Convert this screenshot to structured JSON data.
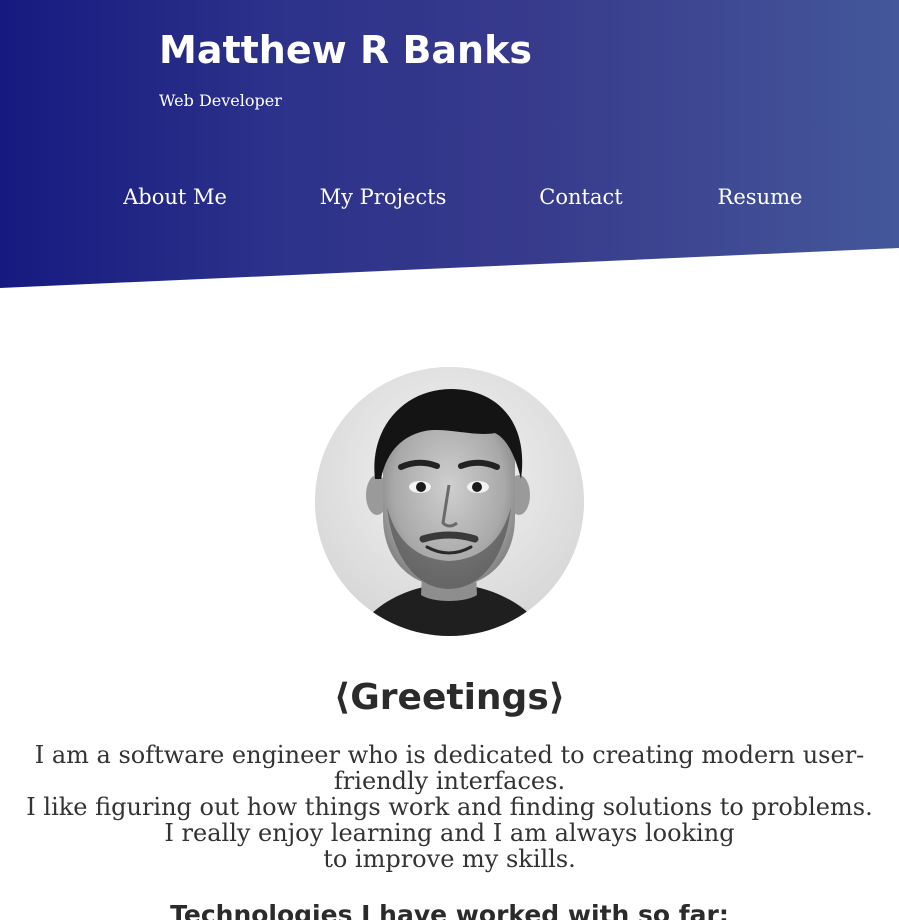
{
  "header": {
    "name": "Matthew R Banks",
    "subtitle": "Web Developer"
  },
  "nav": {
    "items": [
      {
        "label": "About Me"
      },
      {
        "label": "My Projects"
      },
      {
        "label": "Contact"
      },
      {
        "label": "Resume"
      }
    ]
  },
  "profile": {
    "photo_icon": "profile-photo",
    "greeting": "⟨Greetings⟩",
    "intro_lines": [
      "I am a software engineer who is dedicated to creating modern user-",
      "friendly interfaces.",
      "I like figuring out how things work and finding solutions to problems.",
      "I really enjoy learning and I am always looking",
      "to improve my skills."
    ]
  },
  "technologies": {
    "heading": "Technologies I have worked with so far:"
  },
  "colors": {
    "header_gradient_start": "#161a80",
    "header_gradient_end": "#44579a",
    "text": "#333333"
  }
}
